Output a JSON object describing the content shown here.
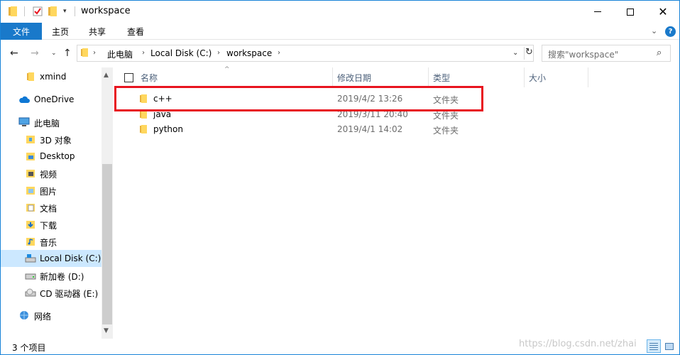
{
  "title": "workspace",
  "ribbon": {
    "file": "文件",
    "home": "主页",
    "share": "共享",
    "view": "查看"
  },
  "address": {
    "crumbs": [
      "此电脑",
      "Local Disk (C:)",
      "workspace"
    ]
  },
  "search": {
    "placeholder": "搜索\"workspace\""
  },
  "sidebar": {
    "items": [
      {
        "label": "xmind",
        "icon": "folder-icon"
      },
      {
        "label": "OneDrive",
        "icon": "onedrive-icon"
      },
      {
        "label": "此电脑",
        "icon": "this-pc-icon"
      },
      {
        "label": "3D 对象",
        "icon": "3d-objects-icon"
      },
      {
        "label": "Desktop",
        "icon": "desktop-icon"
      },
      {
        "label": "视频",
        "icon": "videos-icon"
      },
      {
        "label": "图片",
        "icon": "pictures-icon"
      },
      {
        "label": "文档",
        "icon": "documents-icon"
      },
      {
        "label": "下载",
        "icon": "downloads-icon"
      },
      {
        "label": "音乐",
        "icon": "music-icon"
      },
      {
        "label": "Local Disk (C:)",
        "icon": "local-disk-icon"
      },
      {
        "label": "新加卷 (D:)",
        "icon": "drive-icon"
      },
      {
        "label": "CD 驱动器 (E:)",
        "icon": "cd-drive-icon"
      },
      {
        "label": "网络",
        "icon": "network-icon"
      }
    ]
  },
  "columns": {
    "name": "名称",
    "date": "修改日期",
    "type": "类型",
    "size": "大小"
  },
  "files": [
    {
      "name": "c++",
      "date": "2019/4/2 13:26",
      "type": "文件夹"
    },
    {
      "name": "java",
      "date": "2019/3/11 20:40",
      "type": "文件夹"
    },
    {
      "name": "python",
      "date": "2019/4/1 14:02",
      "type": "文件夹"
    }
  ],
  "status": {
    "count": "3 个项目"
  },
  "watermark": "https://blog.csdn.net/zhai",
  "colors": {
    "accent": "#1979ca",
    "selection": "#cce8ff",
    "highlight_box": "#e8141f",
    "folder": "#ffd75e"
  }
}
